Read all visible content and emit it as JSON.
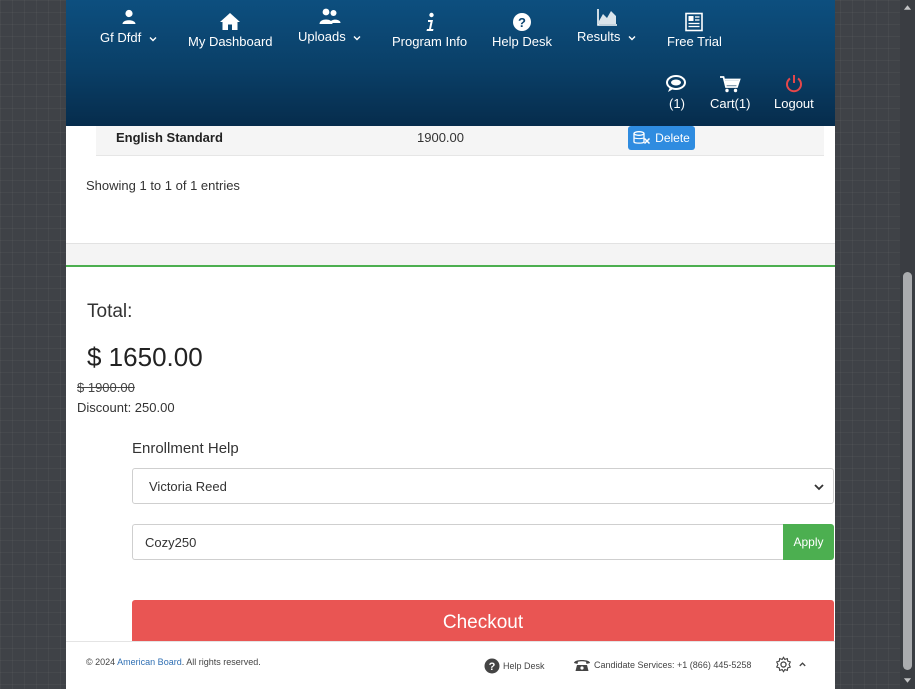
{
  "nav": {
    "user": {
      "label": "Gf Dfdf",
      "icon": "user-icon"
    },
    "dashboard": {
      "label": "My Dashboard",
      "icon": "home-icon"
    },
    "uploads": {
      "label": "Uploads",
      "icon": "users-icon"
    },
    "program_info": {
      "label": "Program Info",
      "icon": "info-icon"
    },
    "help_desk": {
      "label": "Help Desk",
      "icon": "question-icon"
    },
    "results": {
      "label": "Results",
      "icon": "chart-icon"
    },
    "free_trial": {
      "label": "Free Trial",
      "icon": "newspaper-icon"
    },
    "messages": {
      "label": "(1)",
      "icon": "chat-icon"
    },
    "cart": {
      "label": "Cart(1)",
      "icon": "cart-icon"
    },
    "logout": {
      "label": "Logout",
      "icon": "power-icon"
    }
  },
  "table": {
    "row": {
      "course": "English Standard",
      "price": "1900.00",
      "delete_label": "Delete"
    },
    "showing": "Showing 1 to 1 of 1 entries"
  },
  "summary": {
    "total_label": "Total:",
    "total_value": "$ 1650.00",
    "original_price": "$ 1900.00",
    "discount": "Discount: 250.00"
  },
  "enrollment": {
    "label": "Enrollment Help",
    "selected": "Victoria Reed"
  },
  "coupon": {
    "value": "Cozy250",
    "apply_label": "Apply"
  },
  "checkout_label": "Checkout",
  "footer": {
    "copyright_prefix": "© 2024 ",
    "company": "American Board",
    "copyright_suffix": ". All rights reserved.",
    "help_desk": "Help Desk",
    "candidate_services": "Candidate Services: +1 (866) 445-5258"
  },
  "colors": {
    "nav": "#0a3f67",
    "accent_blue": "#2f8ce0",
    "green": "#4caf50",
    "checkout_red": "#e95553",
    "logout_red": "#e5474a"
  }
}
